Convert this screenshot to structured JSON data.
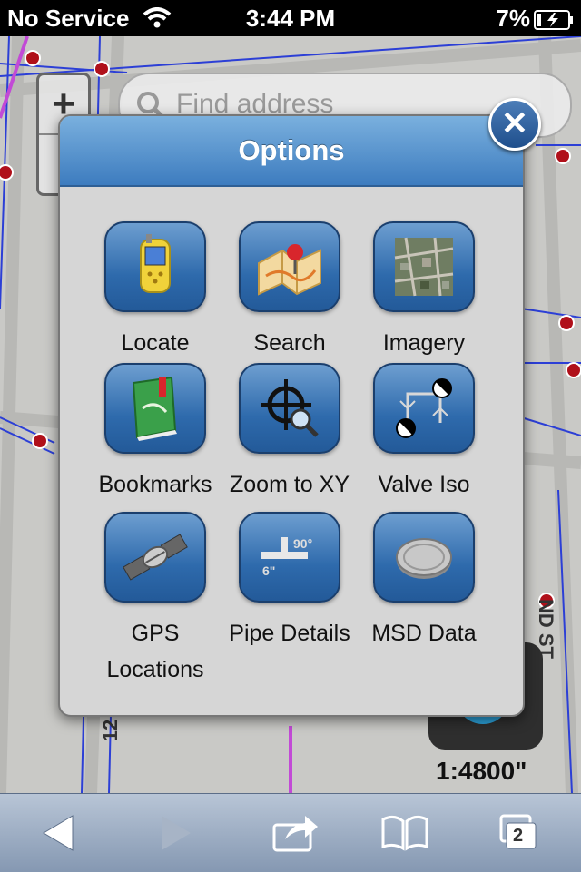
{
  "status_bar": {
    "carrier": "No Service",
    "time": "3:44 PM",
    "battery_pct": "7%",
    "icons": [
      "wifi-icon",
      "battery-icon"
    ]
  },
  "map": {
    "search_placeholder": "Find address",
    "zoom_in": "+",
    "zoom_out": "-",
    "scale": "1:4800\"",
    "street_labels": [
      "12",
      "ND ST"
    ]
  },
  "dialog": {
    "title": "Options",
    "close_label": "✕",
    "items": [
      {
        "label": "Locate",
        "icon": "gps-device-icon"
      },
      {
        "label": "Search",
        "icon": "map-pin-icon"
      },
      {
        "label": "Imagery",
        "icon": "aerial-imagery-icon"
      },
      {
        "label": "Bookmarks",
        "icon": "bookmark-book-icon"
      },
      {
        "label": "Zoom to XY",
        "icon": "crosshair-magnifier-icon"
      },
      {
        "label": "Valve Iso",
        "icon": "valve-isolation-icon"
      },
      {
        "label": "GPS Locations",
        "icon": "satellite-icon"
      },
      {
        "label": "Pipe Details",
        "icon": "pipe-fitting-icon"
      },
      {
        "label": "MSD Data",
        "icon": "manhole-cover-icon"
      }
    ]
  },
  "toolbar": {
    "tabs_count": "2",
    "buttons": [
      "back-arrow-icon",
      "forward-arrow-icon",
      "share-icon",
      "bookmarks-book-icon",
      "tabs-icon"
    ]
  },
  "colors": {
    "dialog_header": "#3d7cbf",
    "tile_blue": "#2e6aac",
    "map_line_blue": "#2c3fd6",
    "map_node_red": "#b0101a"
  }
}
